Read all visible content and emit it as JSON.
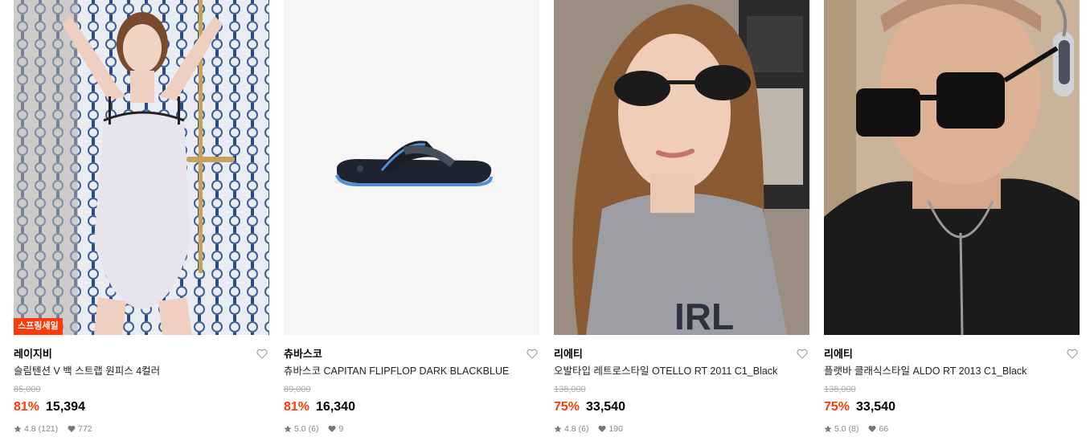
{
  "products": [
    {
      "brand": "레이지비",
      "title": "슬림텐션 V 백 스트랩 원피스 4컬러",
      "original_price": "85,000",
      "discount": "81%",
      "price": "15,394",
      "badge": "스프링세일",
      "rating": "4.8",
      "reviews": "(121)",
      "likes": "772"
    },
    {
      "brand": "츄바스코",
      "title": "츄바스코 CAPITAN FLIPFLOP DARK BLACKBLUE",
      "original_price": "89,000",
      "discount": "81%",
      "price": "16,340",
      "rating": "5.0",
      "reviews": "(6)",
      "likes": "9"
    },
    {
      "brand": "리에티",
      "title": "오발타입 레트로스타일 OTELLO RT 2011 C1_Black",
      "original_price": "138,000",
      "discount": "75%",
      "price": "33,540",
      "rating": "4.8",
      "reviews": "(6)",
      "likes": "190"
    },
    {
      "brand": "리에티",
      "title": "플랫바 클래식스타일 ALDO RT 2013 C1_Black",
      "original_price": "138,000",
      "discount": "75%",
      "price": "33,540",
      "rating": "5.0",
      "reviews": "(8)",
      "likes": "66"
    }
  ],
  "colors": {
    "accent": "#ff3a0a",
    "badge_bg": "#ff3a0a"
  },
  "icons": {
    "like": "heart-outline-icon",
    "rating": "star-icon",
    "likes_count": "heart-filled-icon"
  }
}
